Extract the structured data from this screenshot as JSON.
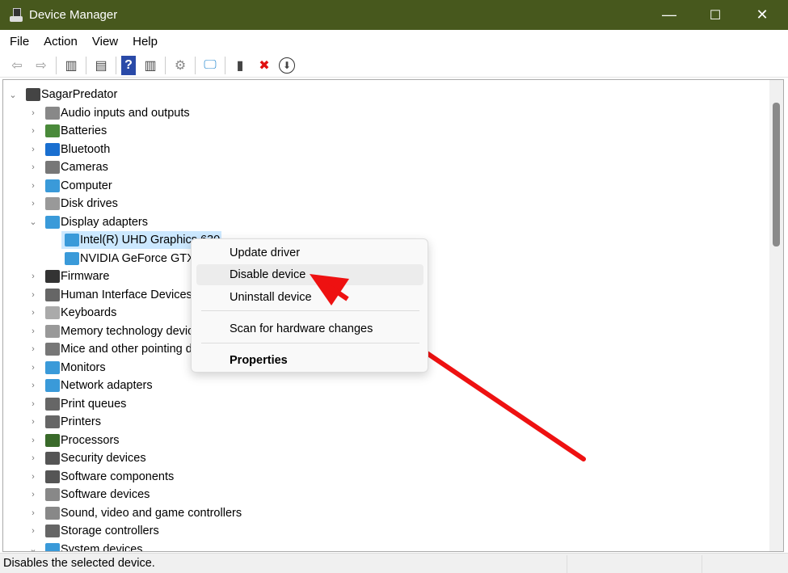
{
  "window": {
    "title": "Device Manager",
    "minimize": "—",
    "maximize": "☐",
    "close": "✕"
  },
  "menu": [
    "File",
    "Action",
    "View",
    "Help"
  ],
  "toolbar": [
    {
      "icon": "back-icon",
      "g": "⇦"
    },
    {
      "icon": "forward-icon",
      "g": "⇨"
    },
    {
      "sep": true
    },
    {
      "icon": "show-hide-console-tree-icon",
      "g": "▥"
    },
    {
      "sep": true
    },
    {
      "icon": "properties-icon",
      "g": "▤"
    },
    {
      "sep": true
    },
    {
      "icon": "help-icon",
      "g": "?"
    },
    {
      "icon": "show-action-pane-icon",
      "g": "▥"
    },
    {
      "sep": true
    },
    {
      "icon": "update-driver-icon",
      "g": "⚙"
    },
    {
      "sep": true
    },
    {
      "icon": "scan-hardware-icon",
      "g": "🖵"
    },
    {
      "sep": true
    },
    {
      "icon": "enable-device-icon",
      "g": "▮"
    },
    {
      "icon": "uninstall-device-icon",
      "g": "✖"
    },
    {
      "icon": "disable-device-icon",
      "g": "⬇"
    }
  ],
  "tree": {
    "root": "SagarPredator",
    "items": [
      {
        "label": "Audio inputs and outputs",
        "color": "#888"
      },
      {
        "label": "Batteries",
        "color": "#4a8a3a"
      },
      {
        "label": "Bluetooth",
        "color": "#1a6fd0"
      },
      {
        "label": "Cameras",
        "color": "#777"
      },
      {
        "label": "Computer",
        "color": "#3a9ad9"
      },
      {
        "label": "Disk drives",
        "color": "#999"
      },
      {
        "label": "Display adapters",
        "color": "#3a9ad9",
        "expanded": true,
        "children": [
          "Intel(R) UHD Graphics 630",
          "NVIDIA GeForce GTX"
        ]
      },
      {
        "label": "Firmware",
        "color": "#333"
      },
      {
        "label": "Human Interface Devices",
        "color": "#666"
      },
      {
        "label": "Keyboards",
        "color": "#aaa"
      },
      {
        "label": "Memory technology devices",
        "color": "#999"
      },
      {
        "label": "Mice and other pointing devices",
        "color": "#777"
      },
      {
        "label": "Monitors",
        "color": "#3a9ad9"
      },
      {
        "label": "Network adapters",
        "color": "#3a9ad9"
      },
      {
        "label": "Print queues",
        "color": "#666"
      },
      {
        "label": "Printers",
        "color": "#666"
      },
      {
        "label": "Processors",
        "color": "#3a6a2a"
      },
      {
        "label": "Security devices",
        "color": "#555"
      },
      {
        "label": "Software components",
        "color": "#555"
      },
      {
        "label": "Software devices",
        "color": "#888"
      },
      {
        "label": "Sound, video and game controllers",
        "color": "#888"
      },
      {
        "label": "Storage controllers",
        "color": "#666"
      },
      {
        "label": "System devices",
        "color": "#3a9ad9",
        "expanded": true
      }
    ]
  },
  "context_menu": {
    "update": "Update driver",
    "disable": "Disable device",
    "uninstall": "Uninstall device",
    "scan": "Scan for hardware changes",
    "properties": "Properties"
  },
  "status": "Disables the selected device.",
  "colors": {
    "titlebar": "#47581d",
    "arrow": "#ee1111",
    "selection": "#cce8ff"
  }
}
